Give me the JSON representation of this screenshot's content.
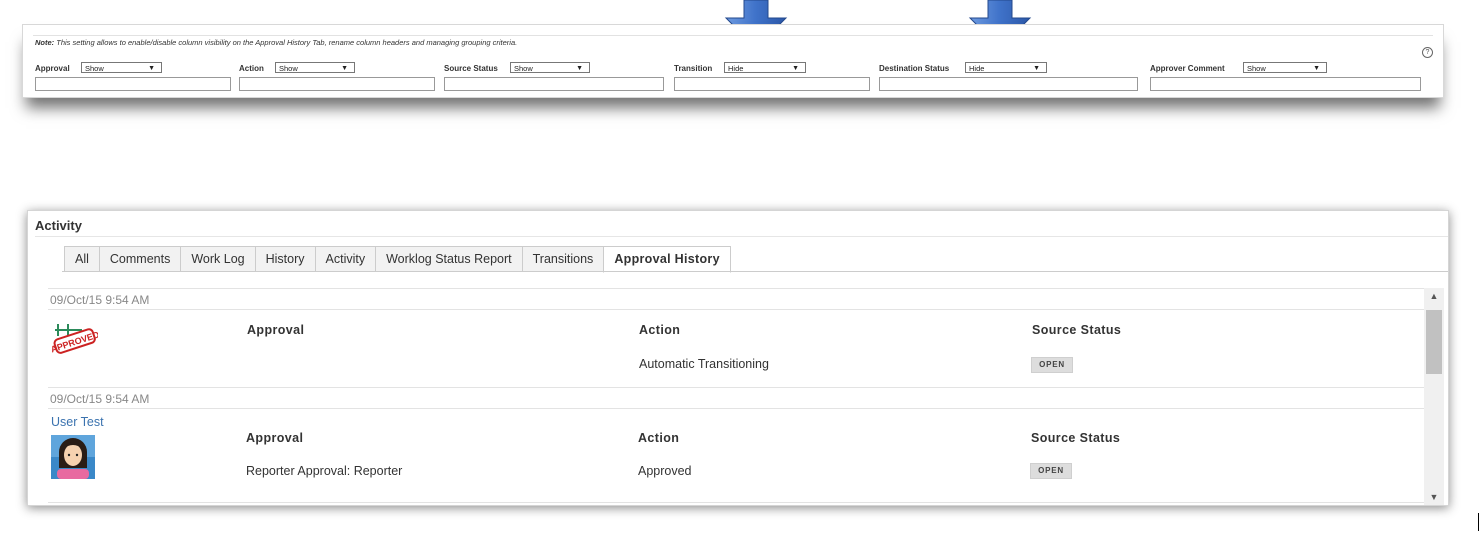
{
  "settings": {
    "note_prefix": "Note:",
    "note_text": "This setting allows to enable/disable column visibility on the Approval History Tab, rename column headers and managing grouping criteria.",
    "help_icon": "?",
    "columns": [
      {
        "label": "Approval",
        "value": "Show"
      },
      {
        "label": "Action",
        "value": "Show"
      },
      {
        "label": "Source Status",
        "value": "Show"
      },
      {
        "label": "Transition",
        "value": "Hide"
      },
      {
        "label": "Destination Status",
        "value": "Hide"
      },
      {
        "label": "Approver Comment",
        "value": "Show"
      }
    ],
    "caret": "▼"
  },
  "arrows": {
    "color": "#3b6fc4",
    "icon": "down-arrow-icon"
  },
  "activity": {
    "title": "Activity",
    "tabs": [
      "All",
      "Comments",
      "Work Log",
      "History",
      "Activity",
      "Worklog Status Report",
      "Transitions",
      "Approval History"
    ],
    "active_tab": "Approval History",
    "entries": [
      {
        "date": "09/Oct/15 9:54 AM",
        "avatar": "approved-stamp-icon",
        "user": "",
        "headers": {
          "approval": "Approval",
          "action": "Action",
          "source_status": "Source Status"
        },
        "values": {
          "approval": "",
          "action": "Automatic Transitioning",
          "source_status": "OPEN"
        }
      },
      {
        "date": "09/Oct/15 9:54 AM",
        "avatar": "user-avatar-icon",
        "user": "User Test",
        "headers": {
          "approval": "Approval",
          "action": "Action",
          "source_status": "Source Status"
        },
        "values": {
          "approval": "Reporter Approval: Reporter",
          "action": "Approved",
          "source_status": "OPEN"
        }
      }
    ],
    "scroll_up": "▲",
    "scroll_down": "▼"
  }
}
